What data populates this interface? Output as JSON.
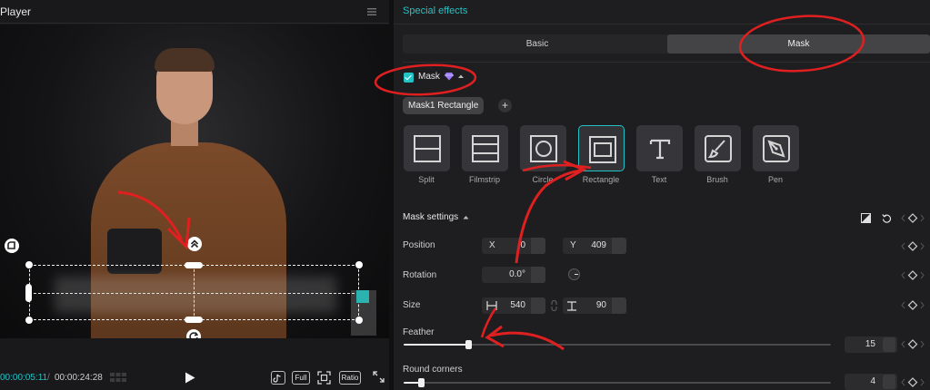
{
  "player": {
    "title": "Player",
    "time_current": "00:00:05:11",
    "time_separator": "/",
    "time_total": "00:00:24:28",
    "buttons": {
      "full": "Full",
      "ratio": "Ratio"
    },
    "icons": [
      "menu-icon",
      "grid-icon",
      "play-icon",
      "tiktok-icon",
      "fullscreen-frame-icon",
      "expand-icon"
    ]
  },
  "panel": {
    "title": "Special effects",
    "tabs": [
      {
        "label": "Basic",
        "active": false
      },
      {
        "label": "Mask",
        "active": true
      }
    ],
    "mask": {
      "label": "Mask",
      "enabled": true,
      "chip": "Mask1 Rectangle",
      "add": "+",
      "shapes": [
        {
          "label": "Split",
          "icon": "split-icon",
          "selected": false
        },
        {
          "label": "Filmstrip",
          "icon": "filmstrip-icon",
          "selected": false
        },
        {
          "label": "Circle",
          "icon": "circle-icon",
          "selected": false
        },
        {
          "label": "Rectangle",
          "icon": "rectangle-icon",
          "selected": true
        },
        {
          "label": "Text",
          "icon": "text-icon",
          "selected": false
        },
        {
          "label": "Brush",
          "icon": "brush-icon",
          "selected": false
        },
        {
          "label": "Pen",
          "icon": "pen-icon",
          "selected": false
        }
      ]
    },
    "settings": {
      "title": "Mask settings",
      "position": {
        "label": "Position",
        "x_prefix": "X",
        "x": "0",
        "y_prefix": "Y",
        "y": "409"
      },
      "rotation": {
        "label": "Rotation",
        "value": "0.0°"
      },
      "size": {
        "label": "Size",
        "width": "540",
        "height": "90"
      },
      "feather": {
        "label": "Feather",
        "value": "15",
        "fraction": 0.15
      },
      "round_corners": {
        "label": "Round corners",
        "value": "4",
        "fraction": 0.04
      }
    },
    "accent_color": "#22c3c6",
    "annotation_color": "#e02020"
  }
}
